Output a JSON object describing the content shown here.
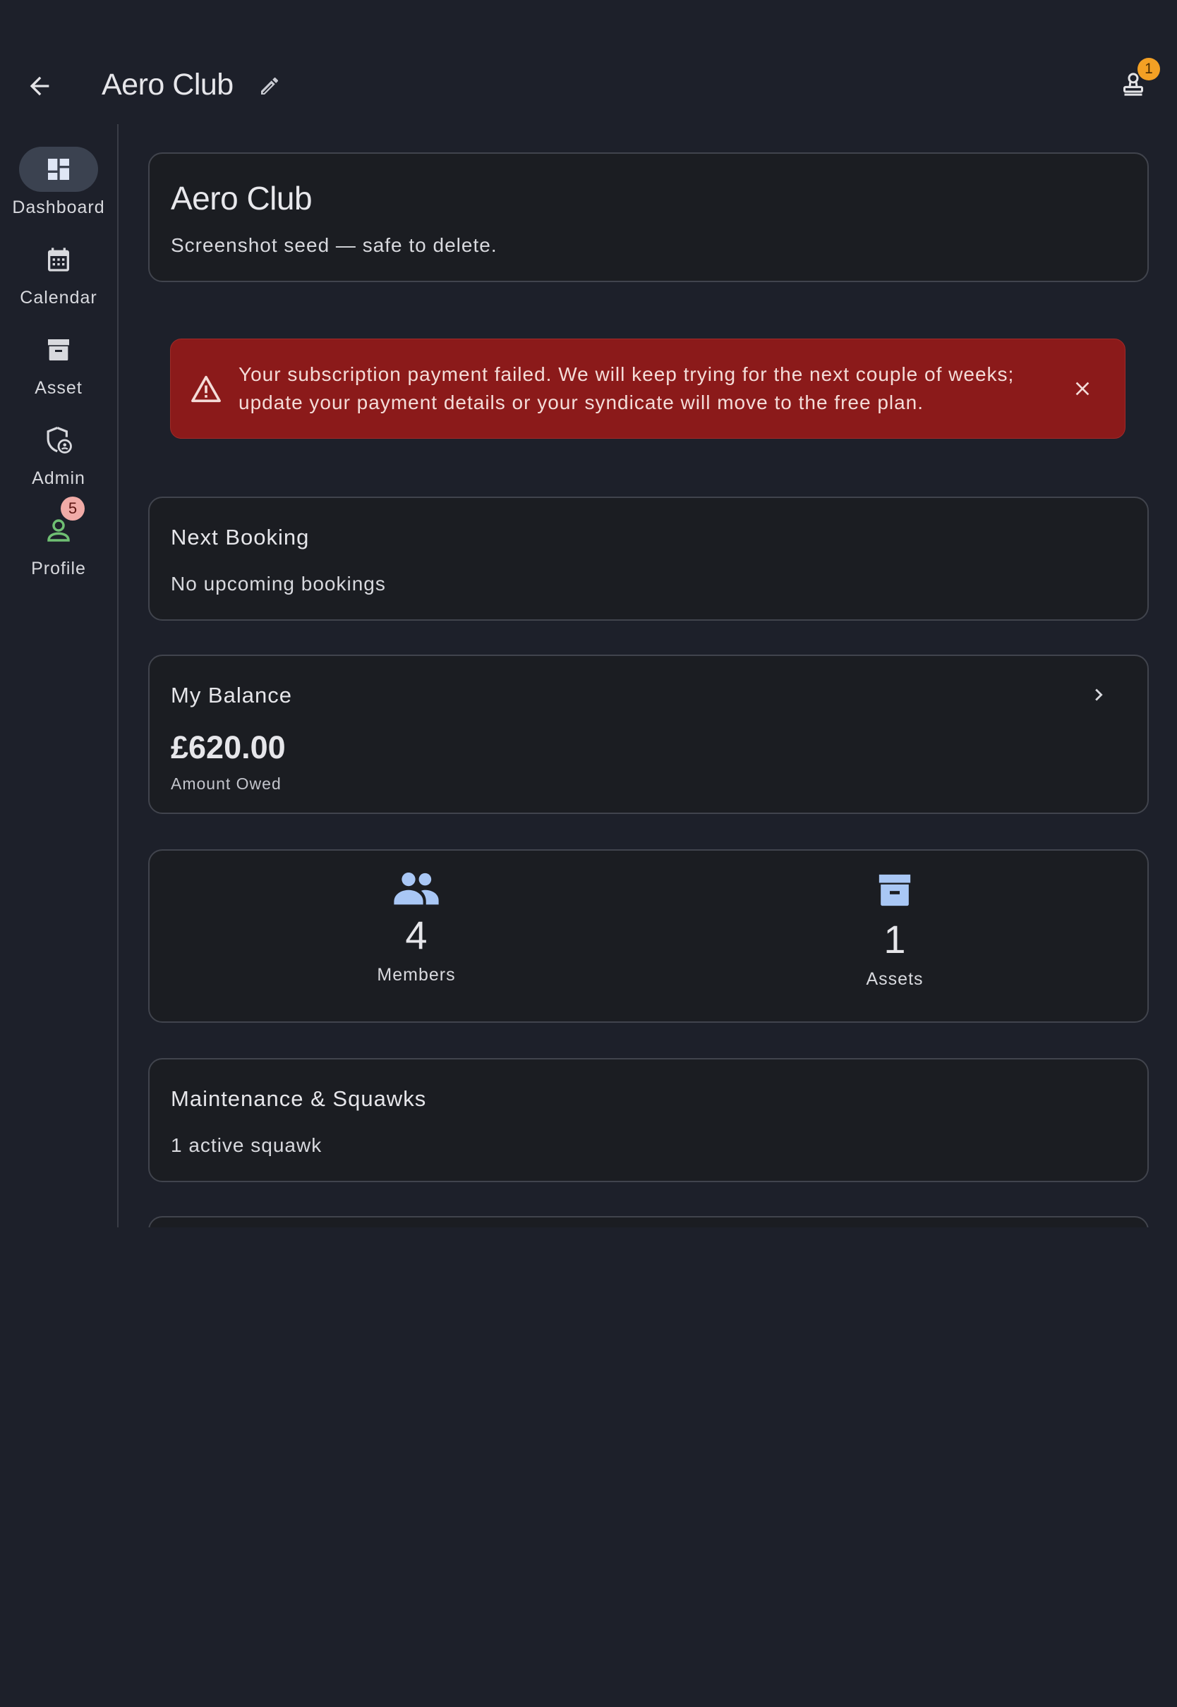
{
  "app_bar": {
    "title": "Aero Club",
    "owner_badge_count": "1"
  },
  "rail": {
    "items": [
      {
        "label": "Dashboard",
        "icon": "dashboard-icon",
        "active": true
      },
      {
        "label": "Calendar",
        "icon": "calendar-icon"
      },
      {
        "label": "Asset",
        "icon": "archive-icon"
      },
      {
        "label": "Admin",
        "icon": "admin-shield-icon"
      },
      {
        "label": "Profile",
        "icon": "person-icon",
        "badge": "5"
      }
    ]
  },
  "club_card": {
    "title": "Aero Club",
    "description": "Screenshot seed — safe to delete."
  },
  "alert": {
    "line1": "Your subscription payment failed. We will keep trying for the next couple of weeks;",
    "line2": "update your payment details or your syndicate will move to the free plan."
  },
  "next_booking": {
    "title": "Next Booking",
    "text": "No upcoming bookings"
  },
  "balance": {
    "title": "My Balance",
    "amount": "£620.00",
    "subtitle": "Amount Owed"
  },
  "stats": {
    "members": {
      "value": "4",
      "label": "Members"
    },
    "assets": {
      "value": "1",
      "label": "Assets"
    }
  },
  "maintenance": {
    "title": "Maintenance & Squawks",
    "text": "1 active squawk"
  },
  "colors": {
    "background": "#1d202a",
    "alert": "#8b1a1a",
    "accent_blue": "#a9c7f5",
    "profile_green": "#6fbf73",
    "badge_orange": "#f3a024"
  }
}
